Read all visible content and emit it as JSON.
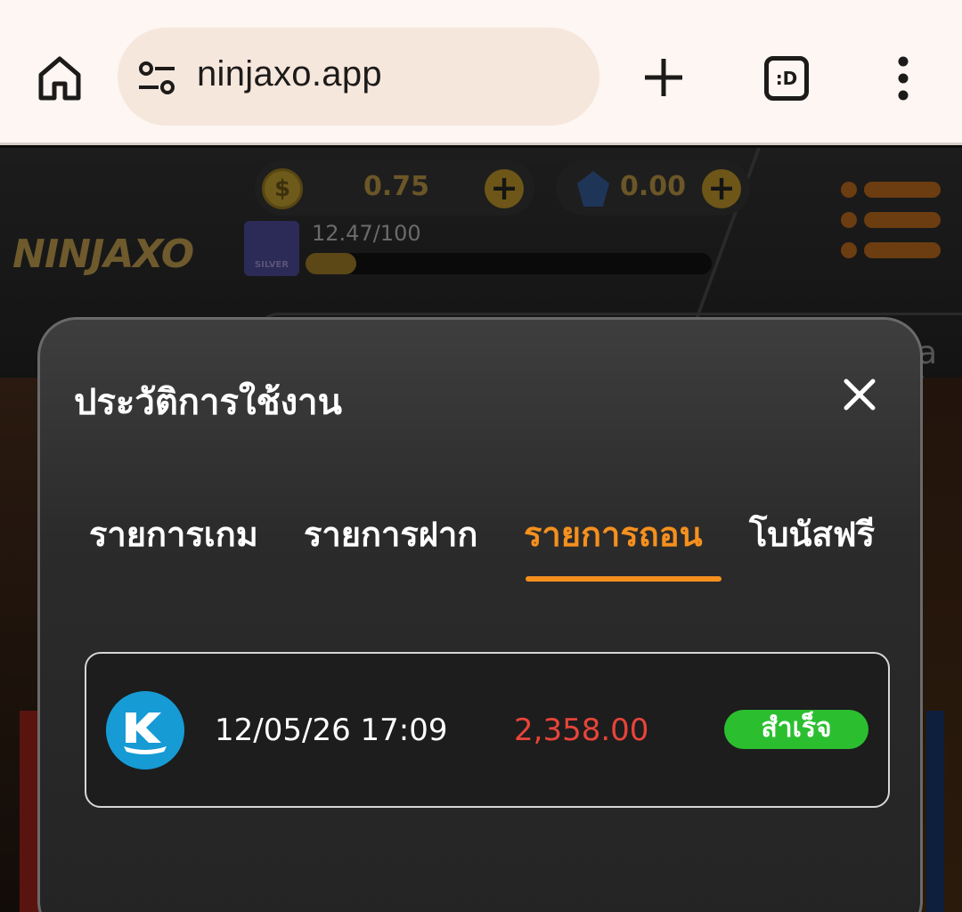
{
  "browser": {
    "url": "ninjaxo.app",
    "tabs_label": ":D"
  },
  "site": {
    "logo_text": "NINJAXO",
    "coin_balance": "0.75",
    "gem_balance": "0.00",
    "rank_badge": "SILVER",
    "xp_text": "12.47/100",
    "xp_progress": 0.1247,
    "banner_fragment": "a Ja",
    "colors": {
      "accent": "#f5901e",
      "gold": "#f0c04a"
    }
  },
  "modal": {
    "title": "ประวัติการใช้งาน",
    "tabs": [
      {
        "label": "รายการเกม",
        "active": false
      },
      {
        "label": "รายการฝาก",
        "active": false
      },
      {
        "label": "รายการถอน",
        "active": true
      },
      {
        "label": "โบนัสฟรี",
        "active": false
      }
    ],
    "records": [
      {
        "bank_icon": "kbank-icon",
        "datetime": "12/05/26 17:09",
        "amount": "2,358.00",
        "status": "สำเร็จ"
      }
    ],
    "colors": {
      "amount": "#e8443a",
      "status_bg": "#2bbf2f",
      "active_tab": "#f5901e"
    }
  }
}
